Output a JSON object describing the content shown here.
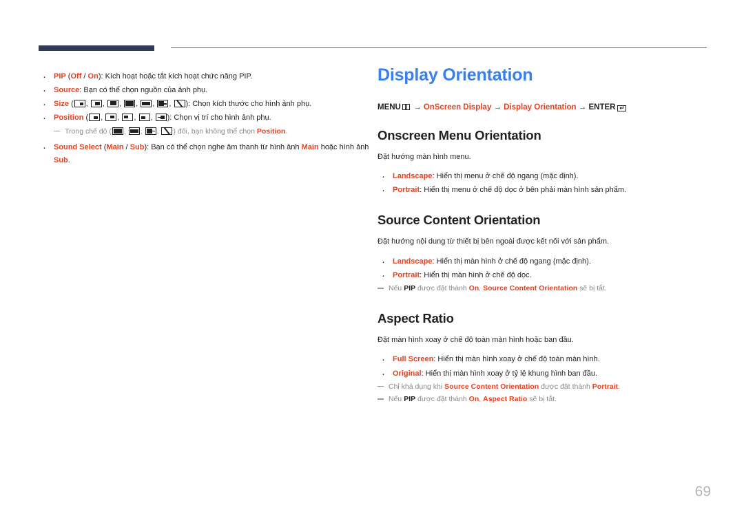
{
  "meta": {
    "page_number": "69",
    "colors": {
      "accent_blue": "#3a7fef",
      "accent_red": "#e8401f",
      "header_bar": "#343a56",
      "note_gray": "#8a8a8a",
      "page_number_gray": "#b6b6b6"
    }
  },
  "left_column": {
    "bullets": [
      {
        "id": "pip",
        "segments": [
          {
            "text": "PIP",
            "style": "red-bold"
          },
          {
            "text": " (",
            "style": "plain"
          },
          {
            "text": "Off",
            "style": "red-bold"
          },
          {
            "text": " / ",
            "style": "plain"
          },
          {
            "text": "On",
            "style": "red-bold"
          },
          {
            "text": "): Kích hoạt hoặc tắt kích hoạt chức năng PIP.",
            "style": "plain"
          }
        ]
      },
      {
        "id": "source",
        "segments": [
          {
            "text": "Source",
            "style": "red-bold"
          },
          {
            "text": ": Bạn có thể chọn nguồn của ảnh phụ.",
            "style": "plain"
          }
        ]
      },
      {
        "id": "size",
        "label": "Size",
        "icons": [
          "sub-small-bottom-right",
          "sub-medium-bottom-right",
          "sub-large-bottom-right",
          "dual-split-tall",
          "dual-split-short",
          "main-left-bar-right",
          "diagonal-split"
        ],
        "tail": "): Chọn kích thước cho hình ảnh phụ."
      },
      {
        "id": "position",
        "label": "Position",
        "icons": [
          "pos-bottom-right",
          "pos-top-right",
          "pos-top-left",
          "pos-bottom-left",
          "pos-bottom-right-arrow"
        ],
        "tail": "): Chọn vị trí cho hình ảnh phụ."
      }
    ],
    "mode_note": {
      "prefix": "Trong chế độ (",
      "icons": [
        "dual-split-tall",
        "dual-split-short",
        "main-left-bar-right",
        "diagonal-split"
      ],
      "middle": ") đôi, bạn không thể chọn ",
      "highlight": "Position",
      "suffix": "."
    },
    "sound_select": {
      "segments": [
        {
          "text": "Sound Select",
          "style": "red-bold"
        },
        {
          "text": " (",
          "style": "plain"
        },
        {
          "text": "Main",
          "style": "red-bold"
        },
        {
          "text": " / ",
          "style": "plain"
        },
        {
          "text": "Sub",
          "style": "red-bold"
        },
        {
          "text": "): Bạn có thể chọn nghe âm thanh từ hình ảnh ",
          "style": "plain"
        },
        {
          "text": "Main",
          "style": "red-bold"
        },
        {
          "text": " hoặc hình ảnh ",
          "style": "plain"
        },
        {
          "text": "Sub",
          "style": "red-bold"
        },
        {
          "text": ".",
          "style": "plain"
        }
      ]
    }
  },
  "right_column": {
    "title": "Display Orientation",
    "menu_path": {
      "menu_label": "MENU",
      "menu_icon": "menu-grid-icon",
      "arrow": "→",
      "step1": "OnScreen Display",
      "step2": "Display Orientation",
      "enter_label": "ENTER",
      "enter_icon": "enter-key-icon"
    },
    "sections": [
      {
        "id": "onscreen-menu-orientation",
        "heading": "Onscreen Menu Orientation",
        "lead": "Đặt hướng màn hình menu.",
        "options": [
          {
            "name": "Landscape",
            "desc": ": Hiển thị menu ở chế độ ngang (mặc định)."
          },
          {
            "name": "Portrait",
            "desc": ": Hiển thị menu ở chế độ dọc ở bên phải màn hình sản phẩm."
          }
        ],
        "notes": []
      },
      {
        "id": "source-content-orientation",
        "heading": "Source Content Orientation",
        "lead": "Đặt hướng nội dung từ thiết bị bên ngoài được kết nối với sản phẩm.",
        "options": [
          {
            "name": "Landscape",
            "desc": ": Hiển thị màn hình ở chế độ ngang (mặc định)."
          },
          {
            "name": "Portrait",
            "desc": ": Hiển thị màn hình ở chế độ dọc."
          }
        ],
        "notes": [
          {
            "segments": [
              {
                "text": "Nếu ",
                "style": "gray"
              },
              {
                "text": "PIP",
                "style": "black-bold"
              },
              {
                "text": " được đặt thành ",
                "style": "gray"
              },
              {
                "text": "On",
                "style": "red-bold"
              },
              {
                "text": ", ",
                "style": "gray"
              },
              {
                "text": "Source Content Orientation",
                "style": "red-bold"
              },
              {
                "text": " sẽ bị tắt.",
                "style": "gray"
              }
            ]
          }
        ]
      },
      {
        "id": "aspect-ratio",
        "heading": "Aspect Ratio",
        "lead": "Đặt màn hình xoay ở chế độ toàn màn hình hoặc ban đầu.",
        "options": [
          {
            "name": "Full Screen",
            "desc": ": Hiển thị màn hình xoay ở chế độ toàn màn hình."
          },
          {
            "name": "Original",
            "desc": ": Hiển thị màn hình xoay ở tỷ lệ khung hình ban đầu."
          }
        ],
        "notes": [
          {
            "segments": [
              {
                "text": "Chỉ khả dụng khi ",
                "style": "gray"
              },
              {
                "text": "Source Content Orientation",
                "style": "red-bold"
              },
              {
                "text": " được đặt thành ",
                "style": "gray"
              },
              {
                "text": "Portrait",
                "style": "red-bold"
              },
              {
                "text": ".",
                "style": "gray"
              }
            ]
          },
          {
            "segments": [
              {
                "text": "Nếu ",
                "style": "gray"
              },
              {
                "text": "PIP",
                "style": "black-bold"
              },
              {
                "text": " được đặt thành ",
                "style": "gray"
              },
              {
                "text": "On",
                "style": "red-bold"
              },
              {
                "text": ", ",
                "style": "gray"
              },
              {
                "text": "Aspect Ratio",
                "style": "red-bold"
              },
              {
                "text": " sẽ bị tắt.",
                "style": "gray"
              }
            ]
          }
        ]
      }
    ]
  }
}
